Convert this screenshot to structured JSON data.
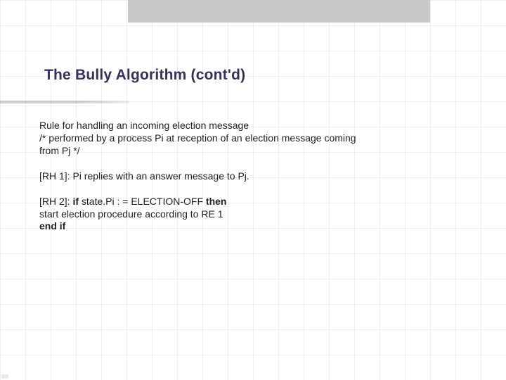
{
  "title": "The Bully Algorithm (cont'd)",
  "para1": {
    "line1": "Rule for handling an incoming election message",
    "line2": "/* performed by a process Pi at reception of an election message coming",
    "line3": "from Pj */"
  },
  "rh1": "[RH 1]: Pi replies with an answer message to Pj.",
  "rh2": {
    "label": "[RH 2]:",
    "if": "if",
    "cond": "state.Pi : = ELECTION-OFF",
    "then": "then",
    "line2": "start election procedure according to RE 1",
    "endif": "end if"
  }
}
